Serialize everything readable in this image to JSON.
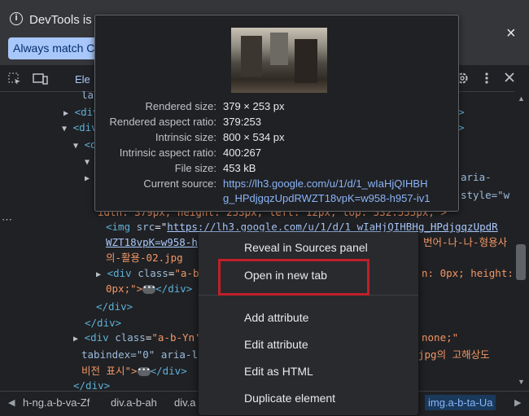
{
  "infobar": {
    "message": "DevTools is n",
    "button_label": "Always match Ch",
    "close": "×"
  },
  "toolbar": {
    "tab_elements": "Ele"
  },
  "tree": {
    "l0": "labe",
    "l1_tag": "<div",
    "l1_gt": ">",
    "l2_tag": "<div",
    "l2_gt": ">",
    "l3_tag": "<d",
    "l4_frag_a": "aria-",
    "l4_frag_b": "style=\"w",
    "l5_frag": "idth: 379px; height: 253px; left: 12px; top: 532.555px;\">",
    "img_open": "<img",
    "img_src_attr": "src",
    "img_src_val_1": "https://lh3.google.com/u/1/d/1_wIaHjQIHBHg_HPdjgqzUpdR",
    "img_src_val_2": "WZT18vpK=w958-h",
    "img_right_1": "번어-나-나-형용사",
    "img_line3": "의-활용-02.jpg",
    "div_ab_1": "<div",
    "div_ab_class": "class",
    "div_ab_val": "\"a-b",
    "div_ab_right": "n: 0px; height:",
    "div_ab_2": "0px;\">",
    "div_ab_close": "</div>",
    "close_div_1": "</div>",
    "close_div_2": "</div>",
    "yn_open": "<div",
    "yn_class": "class",
    "yn_val": "\"a-b-Yn'",
    "yn_right": "none;\"",
    "yn_tabindex": "tabindex=\"0\" aria-l",
    "yn_right2": "jpg의 고해상도",
    "yn_text": "비전 표시\">",
    "yn_close": "</div>",
    "close_div_3": "</div>"
  },
  "tooltip": {
    "rows": [
      {
        "label": "Rendered size:",
        "value": "379 × 253 px"
      },
      {
        "label": "Rendered aspect ratio:",
        "value": "379:253"
      },
      {
        "label": "Intrinsic size:",
        "value": "800 × 534 px"
      },
      {
        "label": "Intrinsic aspect ratio:",
        "value": "400:267"
      },
      {
        "label": "File size:",
        "value": "453 kB"
      },
      {
        "label": "Current source:",
        "value": "https://lh3.google.com/u/1/d/1_wIaHjQIHBH"
      }
    ],
    "source_line2": "g_HPdjgqzUpdRWZT18vpK=w958-h957-iv1"
  },
  "context_menu": {
    "items": [
      "Reveal in Sources panel",
      "Open in new tab",
      "Add attribute",
      "Edit attribute",
      "Edit as HTML",
      "Duplicate element"
    ]
  },
  "breadcrumbs": {
    "items": [
      "h-ng.a-b-va-Zf",
      "div.a-b-ah",
      "div.a",
      "img.a-b-ta-Ua"
    ]
  }
}
